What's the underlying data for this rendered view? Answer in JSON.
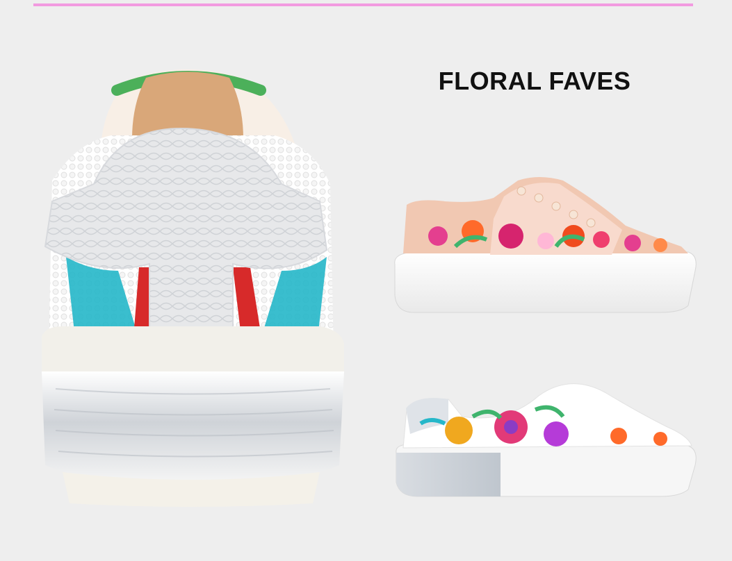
{
  "header": {
    "accent_color": "#f29ae0"
  },
  "section": {
    "title": "FLORAL FAVES"
  },
  "products": [
    {
      "name": "hero-sneaker-back-view",
      "colors": [
        "#ffffff",
        "#dcdcdc",
        "#25b7c9",
        "#d72a2a",
        "#38a84a"
      ]
    },
    {
      "name": "blush-floral-platform-sneaker",
      "colors": [
        "#f1c8b2",
        "#e43f8f",
        "#ff6a2a",
        "#ffffff"
      ]
    },
    {
      "name": "white-floral-beaded-sneaker",
      "colors": [
        "#ffffff",
        "#dfe3e8",
        "#c33c8a",
        "#f0a81f",
        "#3fb46d"
      ]
    }
  ]
}
